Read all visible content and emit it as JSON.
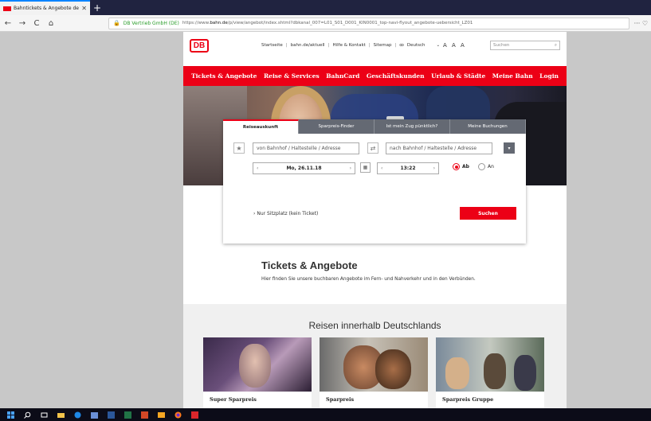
{
  "browser": {
    "tab_title": "Bahntickets & Angebote der D",
    "tab_close": "✕",
    "new_tab": "+",
    "nav": {
      "back": "←",
      "forward": "→",
      "reload": "C",
      "home": "⌂"
    },
    "site_identity": "DB Vertrieb GmbH (DE)",
    "url_prefix": "https://www.",
    "url_domain": "bahn.de",
    "url_path": "/p/view/angebot/index.shtml?dbkanal_007=L01_S01_D001_KIN0001_top-navi-flyout_angebote-uebersicht_LZ01",
    "menu": "··· ♡"
  },
  "header": {
    "logo": "DB",
    "toplinks": [
      "Startseite",
      "bahn.de/aktuell",
      "Hilfe & Kontakt",
      "Sitemap",
      "Deutsch"
    ],
    "language_icon": "ꝏ",
    "language_chevron": "⌄",
    "font_sizes": "A A A",
    "search_placeholder": "Suchen",
    "search_icon": "⌕"
  },
  "main_nav": [
    "Tickets & Angebote",
    "Reise & Services",
    "BahnCard",
    "Geschäftskunden",
    "Urlaub & Städte",
    "Meine Bahn",
    "Login"
  ],
  "booking": {
    "tabs": [
      "Reiseauskunft",
      "Sparpreis-Finder",
      "Ist mein Zug pünktlich?",
      "Meine Buchungen"
    ],
    "active_tab": 0,
    "star_icon": "★",
    "swap_icon": "⇄",
    "dropdown_icon": "▾",
    "calendar_icon": "▦",
    "arrow_left": "‹",
    "arrow_right": "›",
    "from_placeholder": "von  Bahnhof / Haltestelle / Adresse",
    "to_placeholder": "nach  Bahnhof / Haltestelle / Adresse",
    "date": "Mo, 26.11.18",
    "time": "13:22",
    "radio_ab": "Ab",
    "radio_an": "An",
    "seat_only": "Nur Sitzplatz (kein Ticket)",
    "seat_only_chevron": "›",
    "search_button": "Suchen"
  },
  "content": {
    "title": "Tickets & Angebote",
    "text": "Hier finden Sie unsere buchbaren Angebote im Fern- und Nahverkehr und in den Verbünden."
  },
  "section": {
    "title": "Reisen innerhalb Deutschlands",
    "cards": [
      "Super Sparpreis",
      "Sparpreis",
      "Sparpreis Gruppe"
    ]
  },
  "taskbar": {
    "icons": [
      "windows-icon",
      "search-icon",
      "task-view-icon",
      "file-explorer-icon",
      "edge-icon",
      "store-icon",
      "word-icon",
      "excel-icon",
      "powerpoint-icon",
      "folder-icon",
      "firefox-icon",
      "app-icon"
    ]
  },
  "colors": {
    "db_red": "#ec0016",
    "tab_gray": "#646973"
  }
}
